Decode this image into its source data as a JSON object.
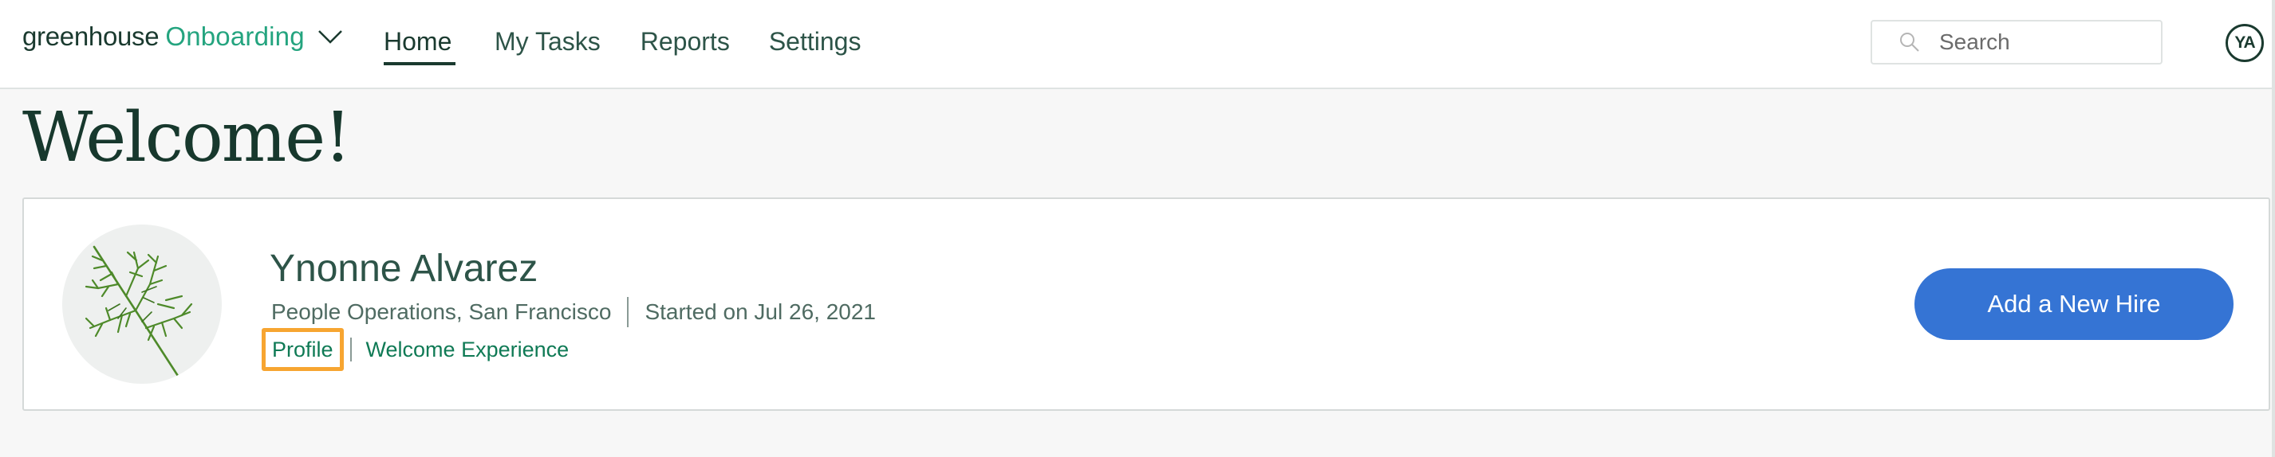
{
  "header": {
    "logo_brand": "greenhouse",
    "logo_product": "Onboarding",
    "product_switcher_icon": "chevron-down-icon",
    "nav": [
      {
        "label": "Home",
        "active": true
      },
      {
        "label": "My Tasks",
        "active": false
      },
      {
        "label": "Reports",
        "active": false
      },
      {
        "label": "Settings",
        "active": false
      }
    ],
    "search": {
      "placeholder": "Search",
      "value": "",
      "icon": "search-icon"
    },
    "user_initials": "YA"
  },
  "main": {
    "title": "Welcome!",
    "hire_card": {
      "avatar_icon": "dill-plant-icon",
      "name": "Ynonne Alvarez",
      "department_location": "People Operations, San Francisco",
      "start_date": "Started on Jul 26, 2021",
      "links": [
        {
          "label": "Profile",
          "highlighted": true
        },
        {
          "label": "Welcome Experience",
          "highlighted": false
        }
      ],
      "primary_action": "Add a New Hire"
    }
  },
  "colors": {
    "brand_dark": "#1a3a2f",
    "brand_green": "#24a47f",
    "link_green": "#0f7a55",
    "primary_button": "#3574d4",
    "highlight_outline": "#f7a531",
    "page_background": "#f7f7f7"
  }
}
